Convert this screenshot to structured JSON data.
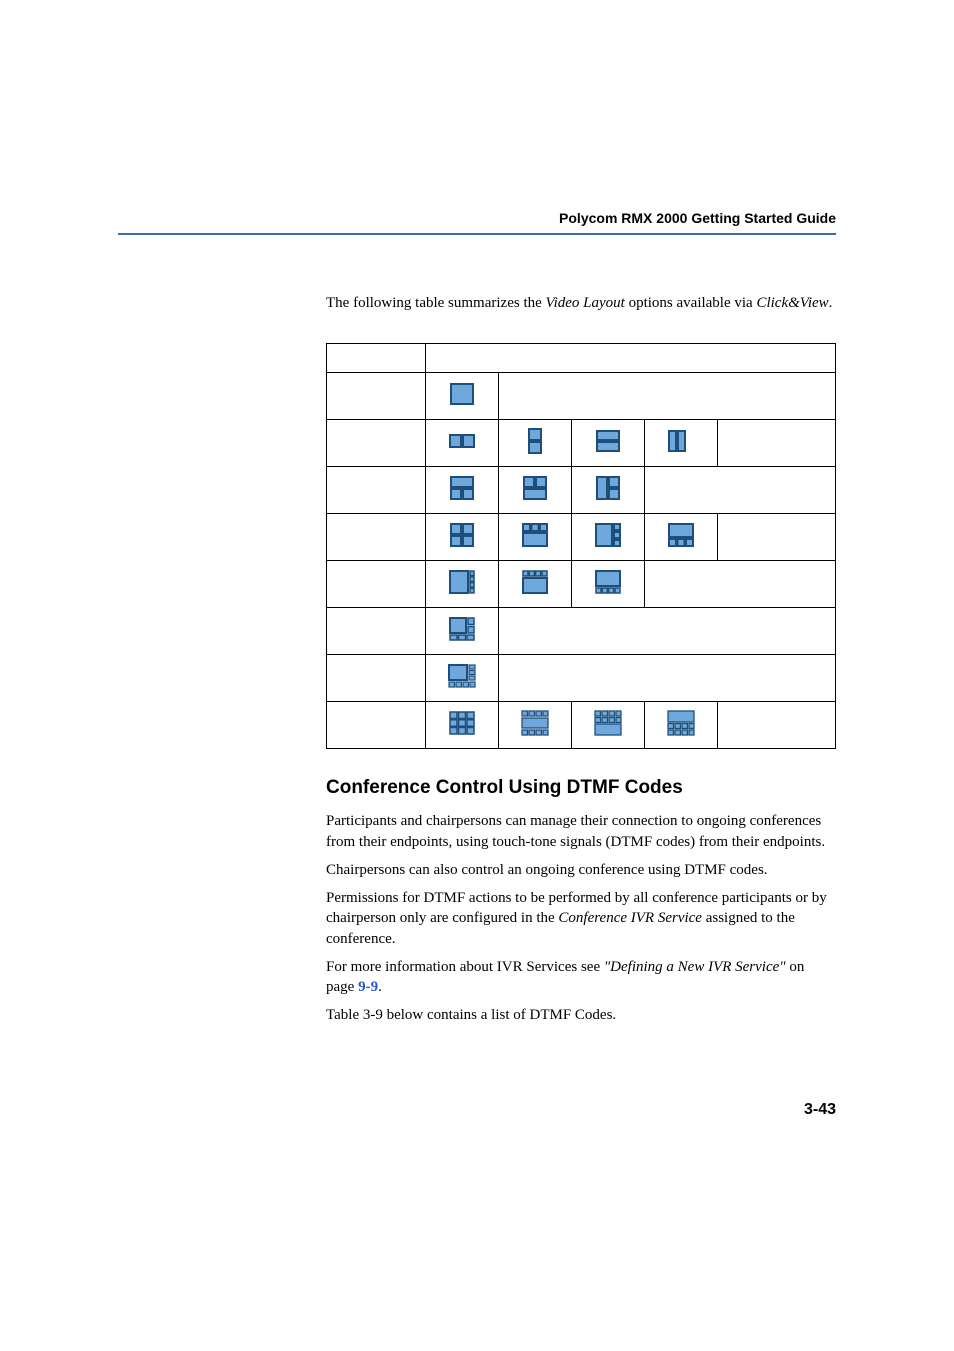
{
  "header": {
    "title": "Polycom RMX 2000 Getting Started Guide"
  },
  "intro": {
    "pre": "The following table summarizes the ",
    "em1": "Video Layout",
    "mid": " options available via ",
    "em2": "Click&View",
    "post": "."
  },
  "section": {
    "heading": "Conference Control Using DTMF Codes",
    "p1": "Participants and chairpersons can manage their connection to ongoing conferences from their endpoints, using touch-tone signals (DTMF codes) from their endpoints.",
    "p2": "Chairpersons can also control an ongoing conference using DTMF codes.",
    "p3_pre": "Permissions for DTMF actions to be performed by all conference participants or by chairperson only are configured in the ",
    "p3_em": "Conference IVR Service",
    "p3_post": " assigned to the conference.",
    "p4_pre": "For more information about IVR Services see ",
    "p4_em": "\"Defining a New IVR Service\"",
    "p4_post": " on page ",
    "p4_link": "9-9",
    "p4_end": ".",
    "p5": "Table 3-9 below contains a list of DTMF Codes."
  },
  "page_number": "3-43",
  "icon_colors": {
    "fill": "#6fa8dc",
    "fill_light": "#b8d5ef",
    "stroke": "#1f4e79"
  }
}
